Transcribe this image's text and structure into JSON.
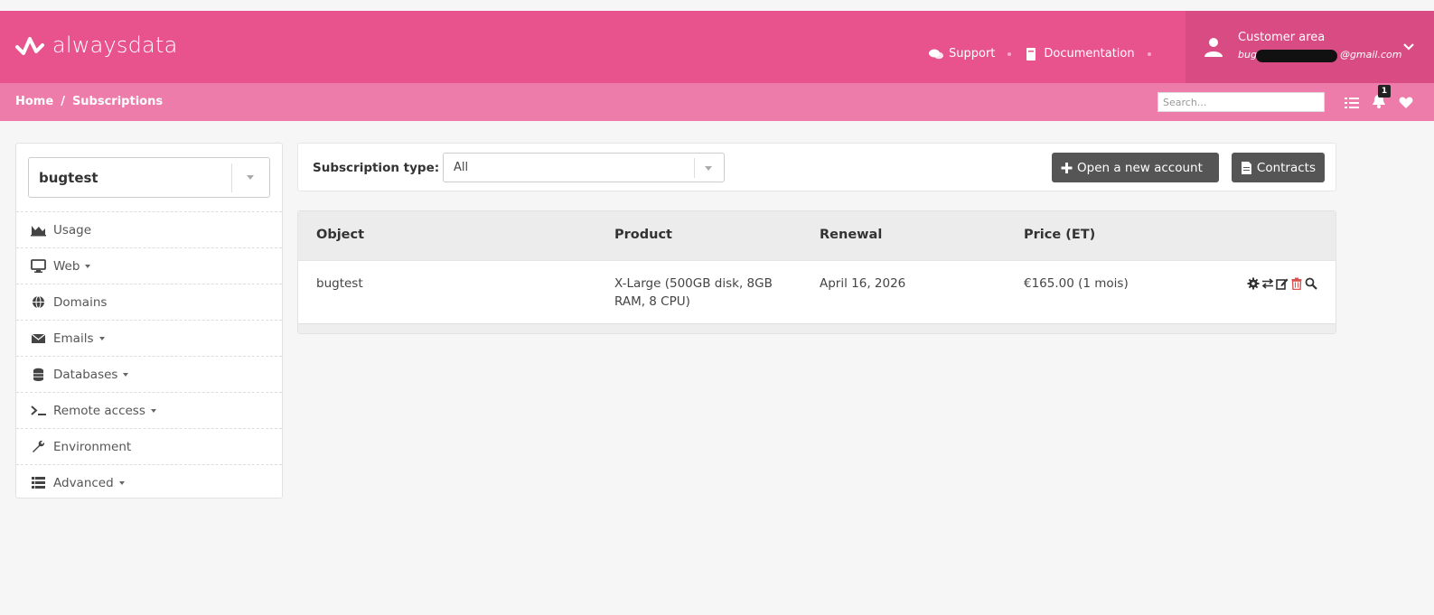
{
  "header": {
    "brand": "alwaysdata",
    "links": [
      {
        "label": "Support",
        "icon": "chat-icon"
      },
      {
        "label": "Documentation",
        "icon": "book-icon"
      }
    ],
    "customer": {
      "title": "Customer area",
      "email_prefix": "bug",
      "email_suffix": "@gmail.com"
    },
    "colors": {
      "primary": "#e8528d",
      "secondary": "#ee7caa",
      "customer_bg": "#d94b83"
    }
  },
  "subheader": {
    "breadcrumb": [
      "Home",
      "/",
      "Subscriptions"
    ],
    "search_placeholder": "Search...",
    "notification_count": "1"
  },
  "sidebar": {
    "account": "bugtest",
    "items": [
      {
        "label": "Usage",
        "icon": "chart-icon",
        "dropdown": false
      },
      {
        "label": "Web",
        "icon": "monitor-icon",
        "dropdown": true
      },
      {
        "label": "Domains",
        "icon": "globe-icon",
        "dropdown": false
      },
      {
        "label": "Emails",
        "icon": "envelope-icon",
        "dropdown": true
      },
      {
        "label": "Databases",
        "icon": "database-icon",
        "dropdown": true
      },
      {
        "label": "Remote access",
        "icon": "terminal-icon",
        "dropdown": true
      },
      {
        "label": "Environment",
        "icon": "wrench-icon",
        "dropdown": false
      },
      {
        "label": "Advanced",
        "icon": "list-icon",
        "dropdown": true
      }
    ]
  },
  "filter": {
    "label": "Subscription type:",
    "selected": "All",
    "open_account": "Open a new account",
    "contracts": "Contracts"
  },
  "table": {
    "columns": [
      "Object",
      "Product",
      "Renewal",
      "Price (ET)"
    ],
    "rows": [
      {
        "object": "bugtest",
        "product_line1": "X-Large (500GB disk, 8GB",
        "product_line2": "RAM, 8 CPU)",
        "renewal": "April 16, 2026",
        "price": "€165.00 (1 mois)"
      }
    ]
  }
}
